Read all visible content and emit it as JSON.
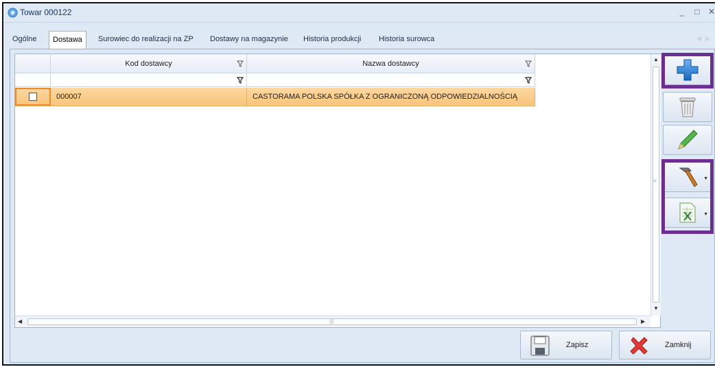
{
  "window": {
    "title": "Towar 000122",
    "minimize": "_",
    "maximize": "□",
    "close": "✕"
  },
  "tabs": [
    {
      "label": "Ogólne",
      "active": false
    },
    {
      "label": "Dostawa",
      "active": true
    },
    {
      "label": "Surowiec do realizacji na ZP",
      "active": false
    },
    {
      "label": "Dostawy na magazynie",
      "active": false
    },
    {
      "label": "Historia produkcji",
      "active": false
    },
    {
      "label": "Historia surowca",
      "active": false
    }
  ],
  "grid": {
    "columns": [
      "",
      "Kod dostawcy",
      "Nazwa dostawcy"
    ],
    "rows": [
      {
        "checked": false,
        "kod": "000007",
        "nazwa": "CASTORAMA POLSKA SPÓŁKA Z OGRANICZONĄ ODPOWIEDZIALNOŚCIĄ"
      }
    ]
  },
  "toolbar": {
    "add": "plus-icon",
    "delete": "trash-icon",
    "edit": "pencil-icon",
    "tools": "hammer-icon",
    "export": "excel-icon"
  },
  "buttons": {
    "save_label": "Zapisz",
    "close_label": "Zamknij"
  },
  "colors": {
    "highlight": "#6a2f91",
    "selected_row": "#f9c983",
    "accent_blue": "#1f7fd6"
  }
}
